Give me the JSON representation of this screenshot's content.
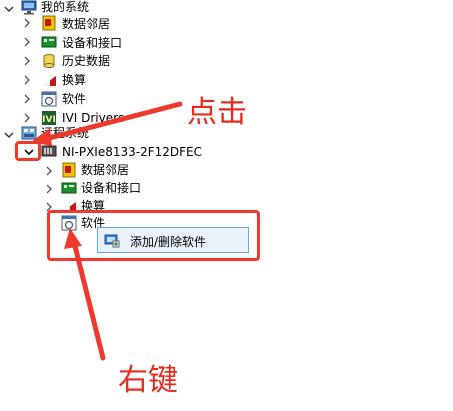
{
  "tree": {
    "my_system": {
      "label": "我的系统",
      "children": [
        "数据邻居",
        "设备和接口",
        "历史数据",
        "换算",
        "软件",
        "IVI Drivers"
      ]
    },
    "remote_systems": {
      "label": "远程系统",
      "device": {
        "label": "NI-PXIe8133-2F12DFEC",
        "children": [
          "数据邻居",
          "设备和接口",
          "换算",
          "软件"
        ]
      }
    }
  },
  "context_menu": {
    "items": [
      "添加/删除软件"
    ]
  },
  "annotations": {
    "click": "点击",
    "right_click": "右键"
  },
  "colors": {
    "annotation": "#e52d1f",
    "menu_bg": "#e9f2fb",
    "menu_border": "#6aa6de"
  }
}
